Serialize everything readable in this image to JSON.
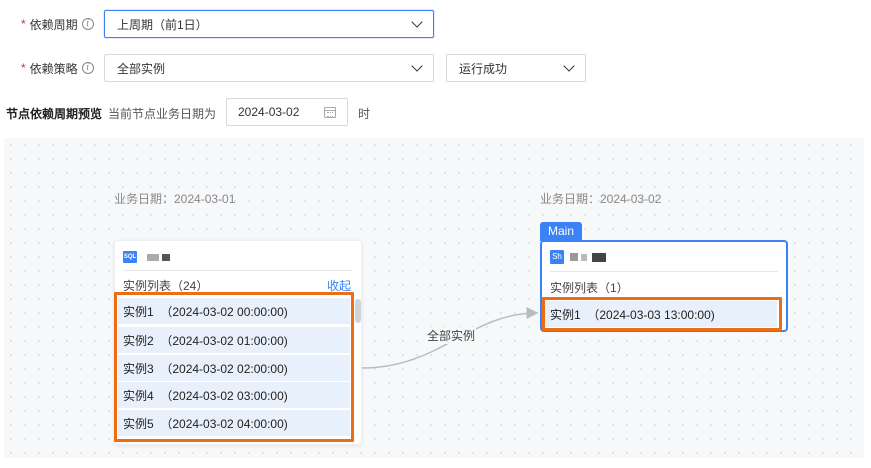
{
  "form": {
    "period": {
      "label": "依赖周期",
      "value": "上周期（前1日）"
    },
    "strategy": {
      "label": "依赖策略",
      "value": "全部实例",
      "status_value": "运行成功"
    }
  },
  "preview": {
    "title": "节点依赖周期预览",
    "subtitle": "当前节点业务日期为",
    "date_value": "2024-03-02",
    "time_suffix": "时"
  },
  "graph": {
    "left": {
      "biz_date": "业务日期：2024-03-01",
      "type_badge": "SQL",
      "list_title": "实例列表（24）",
      "collapse": "收起",
      "instances": [
        "实例1  （2024-03-02 00:00:00)",
        "实例2  （2024-03-02 01:00:00)",
        "实例3  （2024-03-02 02:00:00)",
        "实例4  （2024-03-02 03:00:00)",
        "实例5  （2024-03-02 04:00:00)"
      ]
    },
    "right": {
      "biz_date": "业务日期：2024-03-02",
      "tag": "Main",
      "type_badge": "Sh",
      "list_title": "实例列表（1）",
      "instances": [
        "实例1  （2024-03-03 13:00:00)"
      ]
    },
    "edge_label": "全部实例"
  },
  "colors": {
    "accent": "#3b82f6",
    "highlight": "#ec6d14",
    "required": "#f5222d",
    "instance_bg": "#e8f0fc"
  },
  "icons": [
    "info-icon",
    "chevron-down-icon",
    "calendar-icon",
    "sql-icon",
    "shell-icon"
  ]
}
